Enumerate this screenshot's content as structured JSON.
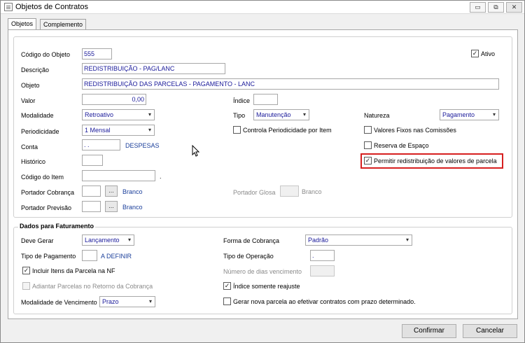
{
  "window": {
    "title": "Objetos de Contratos",
    "min": "▭",
    "max": "⧉",
    "close": "✕"
  },
  "tabs": [
    {
      "label": "Objetos"
    },
    {
      "label": "Complemento"
    }
  ],
  "fields": {
    "codigo_objeto": {
      "label": "Código do Objeto",
      "value": "555"
    },
    "ativo": {
      "label": "Ativo",
      "checked": true
    },
    "descricao": {
      "label": "Descrição",
      "value": "REDISTRIBUIÇÃO - PAG/LANC"
    },
    "objeto": {
      "label": "Objeto",
      "value": "REDISTRIBUIÇÃO DAS PARCELAS - PAGAMENTO - LANC"
    },
    "valor": {
      "label": "Valor",
      "value": "0,00"
    },
    "indice": {
      "label": "Índice",
      "value": ""
    },
    "modalidade": {
      "label": "Modalidade",
      "value": "Retroativo"
    },
    "tipo": {
      "label": "Tipo",
      "value": "Manutenção"
    },
    "natureza": {
      "label": "Natureza",
      "value": "Pagamento"
    },
    "periodicidade": {
      "label": "Periodicidade",
      "value": "1 Mensal"
    },
    "controla_periodicidade": {
      "label": "Controla Periodicidade por Item",
      "checked": false
    },
    "valores_fixos": {
      "label": "Valores Fixos nas Comissões",
      "checked": false
    },
    "conta": {
      "label": "Conta",
      "value": ". .",
      "desc": "DESPESAS"
    },
    "reserva_espaco": {
      "label": "Reserva de Espaço",
      "checked": false
    },
    "historico": {
      "label": "Histórico",
      "value": ""
    },
    "permitir_redistribuicao": {
      "label": "Permitir redistribuição de valores de parcela",
      "checked": true
    },
    "codigo_item": {
      "label": "Código do Item",
      "value": "",
      "suffix": "."
    },
    "portador_cobranca": {
      "label": "Portador Cobrança",
      "value": "",
      "desc": "Branco"
    },
    "portador_glosa": {
      "label": "Portador Glosa",
      "value": "",
      "desc": "Branco"
    },
    "portador_previsao": {
      "label": "Portador Previsão",
      "value": "",
      "desc": "Branco"
    }
  },
  "faturamento": {
    "title": "Dados para Faturamento",
    "deve_gerar": {
      "label": "Deve Gerar",
      "value": "Lançamento"
    },
    "forma_cobranca": {
      "label": "Forma de Cobrança",
      "value": "Padrão"
    },
    "tipo_pagamento": {
      "label": "Tipo de Pagamento",
      "value": "",
      "desc": "A DEFINIR"
    },
    "tipo_operacao": {
      "label": "Tipo de Operação",
      "value": "."
    },
    "incluir_itens": {
      "label": "Incluir Itens da Parcela na NF",
      "checked": true
    },
    "numero_dias": {
      "label": "Número de dias vencimento",
      "value": ""
    },
    "adiantar_parcelas": {
      "label": "Adiantar Parcelas no Retorno da Cobrança",
      "checked": false
    },
    "indice_reajuste": {
      "label": "Índice somente reajuste",
      "checked": true
    },
    "modalidade_vencimento": {
      "label": "Modalidade de Vencimento",
      "value": "Prazo"
    },
    "gerar_nova_parcela": {
      "label": "Gerar nova parcela ao efetivar contratos com prazo determinado.",
      "checked": false
    }
  },
  "icons": {
    "dropdown": "▾",
    "ellipsis": "...",
    "check": "✓"
  },
  "buttons": {
    "confirmar": "Confirmar",
    "cancelar": "Cancelar"
  },
  "colors": {
    "highlight": "#d62020",
    "value_text": "#1a1a9a",
    "link_text": "#1a3e9a"
  }
}
